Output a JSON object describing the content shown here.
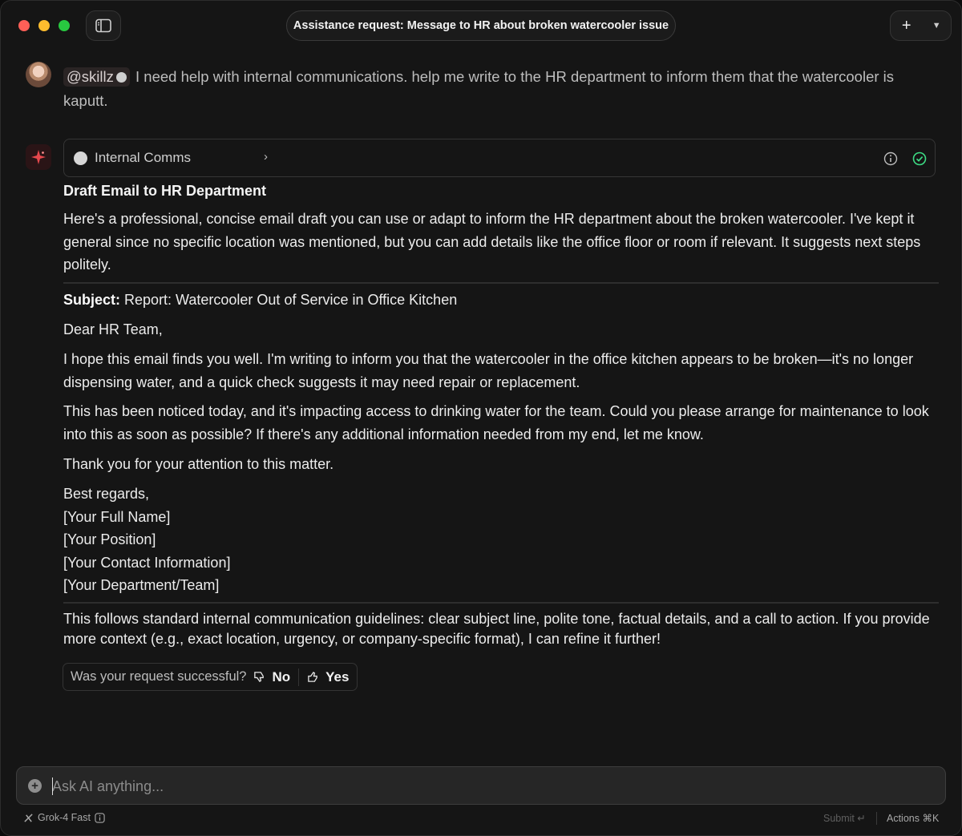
{
  "window": {
    "title": "Assistance request: Message to HR about broken watercooler issue",
    "new_button": "+",
    "new_menu": "⌄"
  },
  "user_message": {
    "mention": "@skillz",
    "text": "I need help with internal communications. help me write to the HR department to inform them that the watercooler is kaputt."
  },
  "skill_card": {
    "name": "Internal Comms",
    "chevron": "›"
  },
  "response": {
    "title": "Draft Email to HR Department",
    "intro": "Here's a professional, concise email draft you can use or adapt to inform the HR department about the broken watercooler. I've kept it general since no specific location was mentioned, but you can add details like the office floor or room if relevant. It suggests next steps politely.",
    "subject_label": "Subject:",
    "subject_value": "Report: Watercooler Out of Service in Office Kitchen",
    "greeting": "Dear HR Team,",
    "body1": "I hope this email finds you well. I'm writing to inform you that the watercooler in the office kitchen appears to be broken—it's no longer dispensing water, and a quick check suggests it may need repair or replacement.",
    "body2": "This has been noticed today, and it's impacting access to drinking water for the team. Could you please arrange for maintenance to look into this as soon as possible? If there's any additional information needed from my end, let me know.",
    "thanks": "Thank you for your attention to this matter.",
    "signoff": [
      "Best regards,",
      "[Your Full Name]",
      "[Your Position]",
      "[Your Contact Information]",
      "[Your Department/Team]"
    ],
    "closing": "This follows standard internal communication guidelines: clear subject line, polite tone, factual details, and a call to action. If you provide more context (e.g., exact location, urgency, or company-specific format), I can refine it further!"
  },
  "feedback": {
    "question": "Was your request successful?",
    "no": "No",
    "yes": "Yes"
  },
  "composer": {
    "placeholder": "Ask AI anything..."
  },
  "footer": {
    "model": "Grok-4 Fast",
    "submit": "Submit ↵",
    "actions": "Actions ⌘K"
  },
  "colors": {
    "background": "#151515",
    "check_green": "#3ddc84",
    "logo_red": "#e5484d"
  }
}
